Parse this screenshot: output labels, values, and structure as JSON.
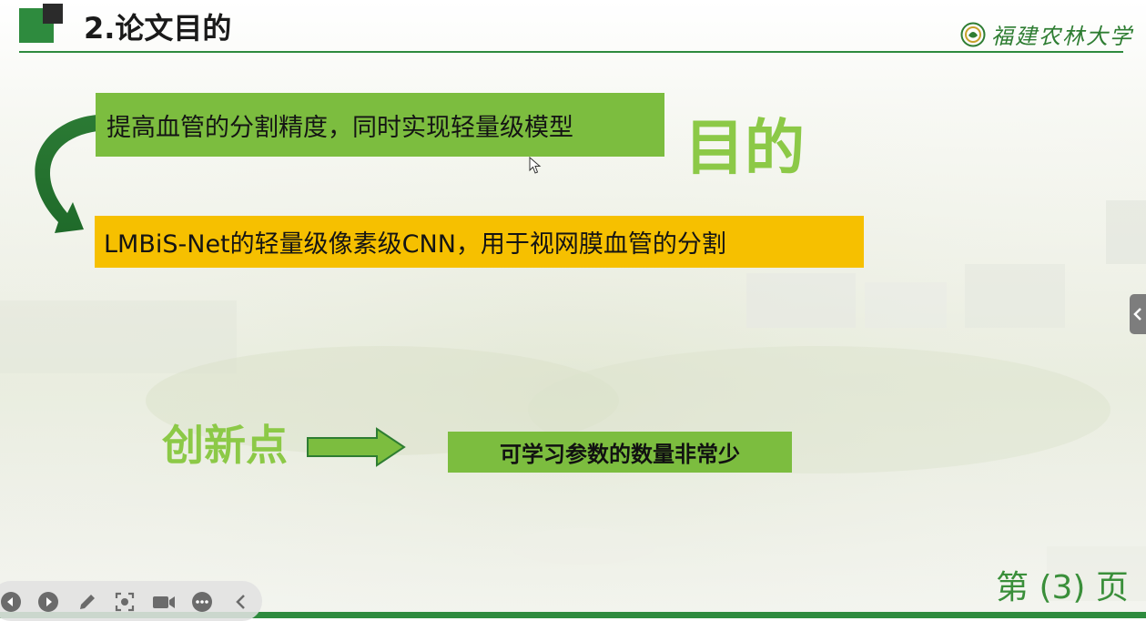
{
  "slide": {
    "title": "2.论文目的",
    "logo_text": "福建农林大学",
    "goal_box": "提高血管的分割精度，同时实现轻量级模型",
    "method_box": "LMBiS-Net的轻量级像素级CNN，用于视网膜血管的分割",
    "purpose_label": "目的",
    "innovation_label": "创新点",
    "innovation_box": "可学习参数的数量非常少",
    "page_number": "第 (3) 页"
  },
  "colors": {
    "brand_green": "#2e8b3e",
    "light_green": "#7cbd3f",
    "label_green": "#8cc947",
    "yellow": "#f6c000"
  },
  "toolbar": {
    "icons": [
      "previous-icon",
      "next-icon",
      "pen-icon",
      "screenshot-icon",
      "camera-icon",
      "more-icon",
      "collapse-icon"
    ]
  }
}
